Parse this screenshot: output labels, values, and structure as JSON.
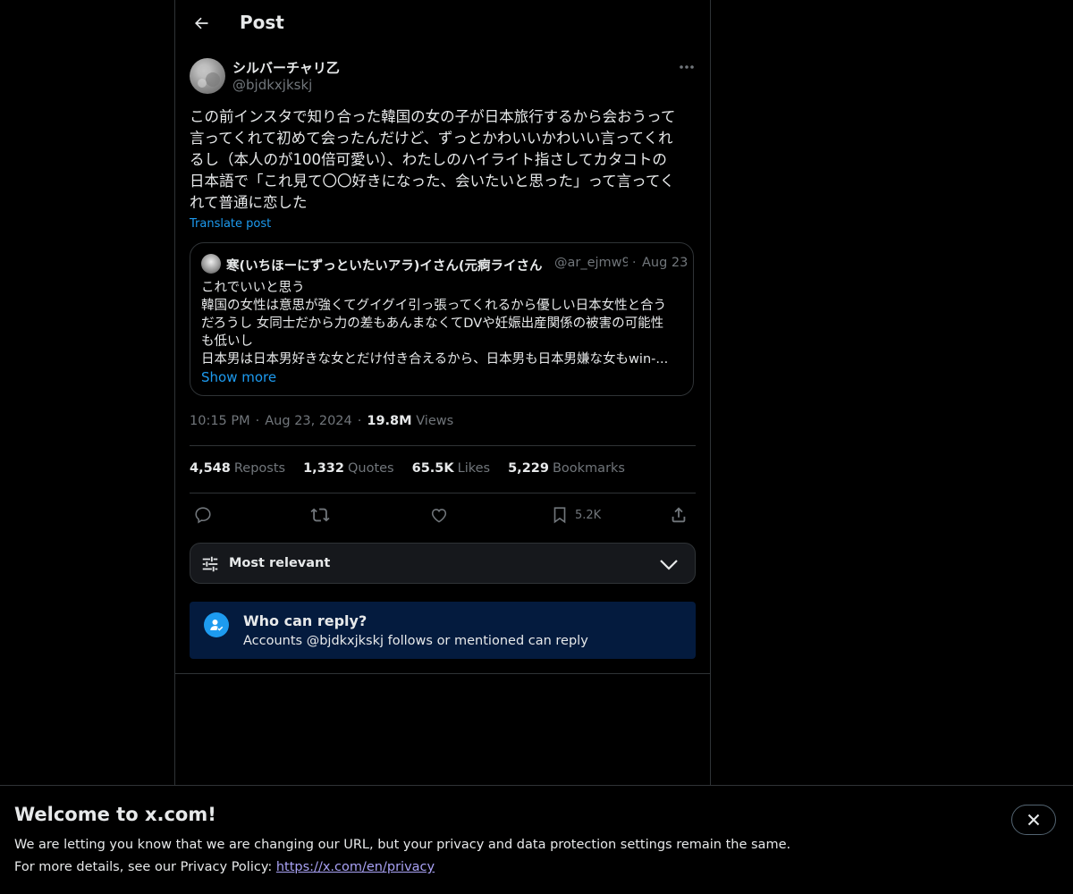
{
  "header": {
    "title": "Post"
  },
  "post": {
    "author_name": "シルバーチャリ乙",
    "author_handle": "@bjdkxjkskj",
    "text": "この前インスタで知り合った韓国の女の子が日本旅行するから会おうって\n言ってくれて初めて会ったんだけど、ずっとかわいいかわいい言ってくれ\nるし（本人のが100倍可愛い）、わたしのハイライト指さしてカタコトの\n日本語で「これ見て〇〇好きになった、会いたいと思った」って言ってく\nれて普通に恋した",
    "translate_label": "Translate post",
    "time": "10:15 PM",
    "date": "Aug 23, 2024",
    "views_count": "19.8M",
    "views_label": "Views"
  },
  "quote": {
    "author_name": "寒(いちほーにずっといたいアラ)イさん(元痾ライさん",
    "author_handle": "@ar_ejmw9",
    "date": "Aug 23",
    "text": "これでいいと思う\n韓国の女性は意思が強くてグイグイ引っ張ってくれるから優しい日本女性と合う\nだろうし 女同士だから力の差もあんまなくてDVや妊娠出産関係の被害の可能性\nも低いし\n日本男は日本男好きな女とだけ付き合えるから、日本男も日本男嫌な女もwin-...",
    "show_more_label": "Show more"
  },
  "stats": {
    "reposts_count": "4,548",
    "reposts_label": "Reposts",
    "quotes_count": "1,332",
    "quotes_label": "Quotes",
    "likes_count": "65.5K",
    "likes_label": "Likes",
    "bookmarks_count": "5,229",
    "bookmarks_label": "Bookmarks"
  },
  "actions": {
    "bookmark_count": "5.2K",
    "icons": [
      "reply-icon",
      "repost-icon",
      "like-icon",
      "bookmark-icon",
      "share-icon"
    ]
  },
  "sort": {
    "label": "Most relevant"
  },
  "reply_restriction": {
    "title": "Who can reply?",
    "description": "Accounts @bjdkxjkskj follows or mentioned can reply"
  },
  "banner": {
    "title": "Welcome to x.com!",
    "line1": "We are letting you know that we are changing our URL, but your privacy and data protection settings remain the same.",
    "line2_prefix": "For more details, see our Privacy Policy: ",
    "link": "https://x.com/en/privacy"
  },
  "colors": {
    "background": "#000000",
    "accent": "#1d9bf0",
    "muted": "#71767b",
    "border": "#2f3336",
    "reply_box": "#041b3e"
  }
}
